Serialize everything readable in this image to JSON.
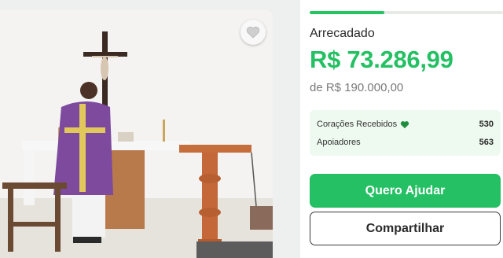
{
  "campaign": {
    "raised_label": "Arrecadado",
    "raised_amount": "R$ 73.286,99",
    "goal_text": "de R$ 190.000,00",
    "progress_fraction": 0.3857,
    "stats": [
      {
        "label": "Corações Recebidos",
        "value": "530",
        "icon": "heart-icon"
      },
      {
        "label": "Apoiadores",
        "value": "563"
      }
    ],
    "primary_button": "Quero Ajudar",
    "secondary_button": "Compartilhar"
  },
  "colors": {
    "accent": "#24c063",
    "stats_bg": "#eefaf0",
    "vestment": "#7d4a9e"
  },
  "photo": {
    "favorite_icon": "heart-outline-icon"
  }
}
